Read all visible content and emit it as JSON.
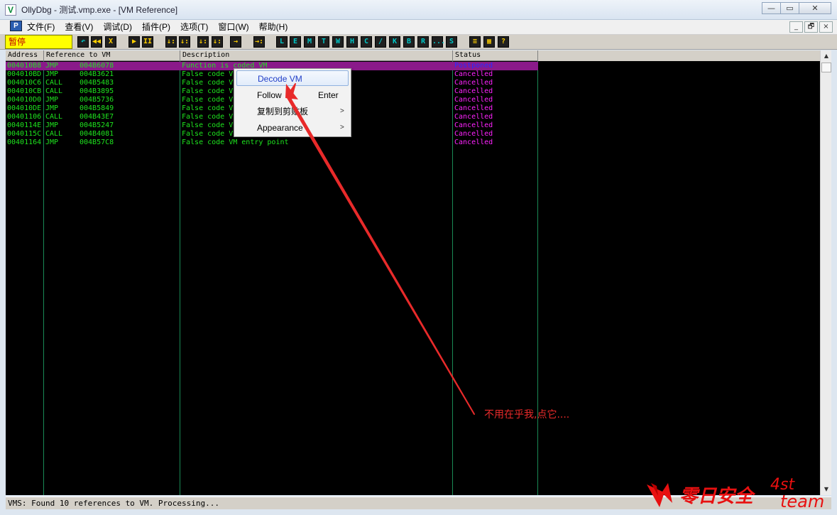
{
  "window": {
    "title": "OllyDbg - 测试.vmp.exe - [VM Reference]",
    "app_icon": "V",
    "buttons": [
      "—",
      "▭",
      "✕"
    ]
  },
  "menu": {
    "icon": "P",
    "items": [
      "文件(F)",
      "查看(V)",
      "调试(D)",
      "插件(P)",
      "选项(T)",
      "窗口(W)",
      "帮助(H)"
    ],
    "mdi_buttons": [
      "_",
      "🗗",
      "×"
    ]
  },
  "toolbar": {
    "status": "暂停",
    "buttons": [
      {
        "glyph": "↶",
        "color": "#00c8c8"
      },
      {
        "glyph": "◀◀",
        "color": "#ffd000"
      },
      {
        "glyph": "X",
        "color": "#ffd000"
      },
      {
        "glyph": "▶",
        "color": "#ffd000"
      },
      {
        "glyph": "II",
        "color": "#ffd000"
      },
      {
        "glyph": "↓:",
        "color": "#ffd000"
      },
      {
        "glyph": "↓:",
        "color": "#ffd000"
      },
      {
        "glyph": "↓:",
        "color": "#ffd000"
      },
      {
        "glyph": "↓:",
        "color": "#ffd000"
      },
      {
        "glyph": "→",
        "color": "#ffd000"
      },
      {
        "glyph": "→:",
        "color": "#ffd000"
      },
      {
        "glyph": "L",
        "color": "#00c8c8"
      },
      {
        "glyph": "E",
        "color": "#00c8c8"
      },
      {
        "glyph": "M",
        "color": "#00c8c8"
      },
      {
        "glyph": "T",
        "color": "#00c8c8"
      },
      {
        "glyph": "W",
        "color": "#00c8c8"
      },
      {
        "glyph": "H",
        "color": "#00c8c8"
      },
      {
        "glyph": "C",
        "color": "#00c8c8"
      },
      {
        "glyph": "/",
        "color": "#00c8c8"
      },
      {
        "glyph": "K",
        "color": "#00c8c8"
      },
      {
        "glyph": "B",
        "color": "#00c8c8"
      },
      {
        "glyph": "R",
        "color": "#00c8c8"
      },
      {
        "glyph": "...",
        "color": "#00c8c8"
      },
      {
        "glyph": "S",
        "color": "#00c8c8"
      },
      {
        "glyph": "≡",
        "color": "#ffd000"
      },
      {
        "glyph": "▦",
        "color": "#ffd000"
      },
      {
        "glyph": "?",
        "color": "#ffd000"
      }
    ]
  },
  "columns": [
    "Address",
    "Reference to VM",
    "Description",
    "Status"
  ],
  "rows": [
    {
      "address": "004010B8",
      "type": "JMP",
      "ref": "004B6078",
      "desc": "Function is coded VM",
      "status": "Postponed",
      "selected": true
    },
    {
      "address": "004010BD",
      "type": "JMP",
      "ref": "004B3621",
      "desc": "False code V",
      "status": "Cancelled"
    },
    {
      "address": "004010C6",
      "type": "CALL",
      "ref": "004B5483",
      "desc": "False code V",
      "status": "Cancelled"
    },
    {
      "address": "004010CB",
      "type": "CALL",
      "ref": "004B3895",
      "desc": "False code V",
      "status": "Cancelled"
    },
    {
      "address": "004010D0",
      "type": "JMP",
      "ref": "004B5736",
      "desc": "False code V",
      "status": "Cancelled"
    },
    {
      "address": "004010DE",
      "type": "JMP",
      "ref": "004B5849",
      "desc": "False code V",
      "status": "Cancelled"
    },
    {
      "address": "00401106",
      "type": "CALL",
      "ref": "004B43E7",
      "desc": "False code V",
      "status": "Cancelled"
    },
    {
      "address": "0040114E",
      "type": "JMP",
      "ref": "004B5247",
      "desc": "False code V",
      "status": "Cancelled"
    },
    {
      "address": "0040115C",
      "type": "CALL",
      "ref": "004B4081",
      "desc": "False code V",
      "status": "Cancelled"
    },
    {
      "address": "00401164",
      "type": "JMP",
      "ref": "004B57C8",
      "desc": "False code VM entry point",
      "status": "Cancelled"
    }
  ],
  "context_menu": {
    "items": [
      {
        "label": "Decode VM",
        "shortcut": "",
        "submenu": false,
        "highlighted": true
      },
      {
        "label": "Follow",
        "shortcut": "Enter",
        "submenu": false
      },
      {
        "label": "复制到剪贴板",
        "shortcut": "",
        "submenu": true
      },
      {
        "label": "Appearance",
        "shortcut": "",
        "submenu": true
      }
    ]
  },
  "status_bar": "VMS: Found 10 references to VM. Processing...",
  "annotation": "不用在乎我,点它....",
  "watermark": {
    "cn": "零日安全",
    "line1": "4st",
    "line2": "team"
  },
  "colors": {
    "list_bg": "#000000",
    "text_green": "#1ee41e",
    "status_magenta": "#ff22ff",
    "selection": "#8a1a8a",
    "annotation_red": "#e82a2a"
  }
}
